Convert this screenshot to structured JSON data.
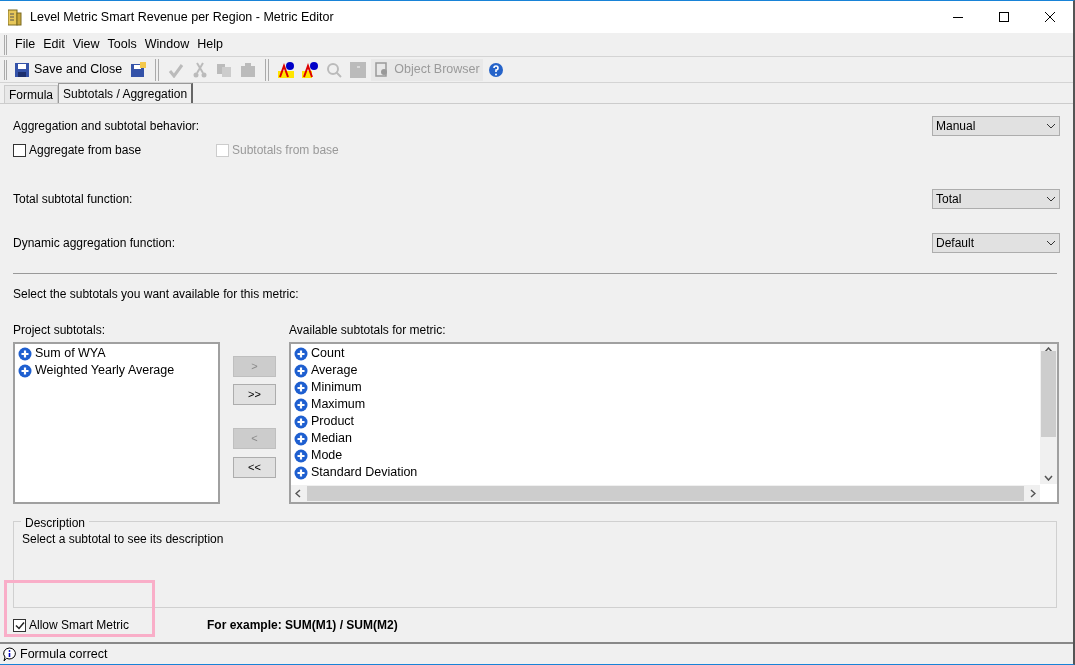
{
  "window": {
    "title": "Level Metric Smart Revenue per Region - Metric Editor"
  },
  "menu": [
    "File",
    "Edit",
    "View",
    "Tools",
    "Window",
    "Help"
  ],
  "toolbar": [
    {
      "kind": "labeled",
      "label": "Save and Close",
      "disabled": false
    },
    {
      "kind": "icon",
      "disabled": false
    },
    {
      "kind": "separator"
    },
    {
      "kind": "icon",
      "disabled": true
    },
    {
      "kind": "icon",
      "disabled": true
    },
    {
      "kind": "icon",
      "disabled": true
    },
    {
      "kind": "icon",
      "disabled": true
    },
    {
      "kind": "separator"
    },
    {
      "kind": "icon",
      "disabled": false
    },
    {
      "kind": "icon",
      "disabled": false
    },
    {
      "kind": "icon",
      "disabled": true
    },
    {
      "kind": "icon",
      "disabled": true
    },
    {
      "kind": "labeled",
      "label": "Object Browser",
      "disabled": true
    },
    {
      "kind": "icon",
      "disabled": false
    }
  ],
  "tabs": [
    {
      "label": "Formula",
      "selected": false
    },
    {
      "label": "Subtotals / Aggregation",
      "selected": true
    }
  ],
  "behavior": {
    "label": "Aggregation and subtotal behavior:",
    "value": "Manual"
  },
  "checkboxes": [
    {
      "label": "Aggregate from base",
      "checked": false,
      "disabled": false
    },
    {
      "label": "Subtotals from base",
      "checked": false,
      "disabled": true
    }
  ],
  "total_function": {
    "label": "Total subtotal function:",
    "value": "Total"
  },
  "dynamic_function": {
    "label": "Dynamic aggregation function:",
    "value": "Default"
  },
  "select_prompt": "Select the subtotals you want available for this metric:",
  "project_subtotals": {
    "label": "Project subtotals:",
    "items": [
      "Sum of WYA",
      "Weighted Yearly Average"
    ]
  },
  "move_buttons": [
    {
      "label": ">",
      "disabled": true
    },
    {
      "label": ">>",
      "disabled": false
    },
    {
      "label": "<",
      "disabled": true
    },
    {
      "label": "<<",
      "disabled": false
    }
  ],
  "available_subtotals": {
    "label": "Available subtotals for metric:",
    "items": [
      "Count",
      "Average",
      "Minimum",
      "Maximum",
      "Product",
      "Median",
      "Mode",
      "Standard Deviation"
    ]
  },
  "description": {
    "title": "Description",
    "text": "Select a subtotal to see its description"
  },
  "smart_metric": {
    "label": "Allow Smart Metric",
    "checked": true
  },
  "example": "For example: SUM(M1) / SUM(M2)",
  "status_bar": "Formula correct"
}
